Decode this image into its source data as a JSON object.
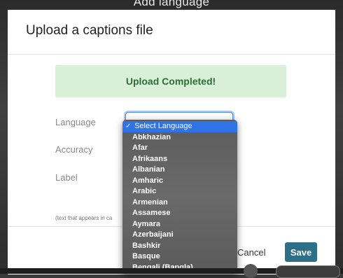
{
  "page_top": {
    "partial_title": "Add language"
  },
  "modal": {
    "title": "Upload a captions file",
    "alert": "Upload Completed!",
    "fields": {
      "language_label": "Language",
      "accuracy_label": "Accuracy",
      "label_label": "Label"
    },
    "helper_text": "(text that appears in ca",
    "footer": {
      "cancel_label": "Cancel",
      "save_label": "Save"
    }
  },
  "language_dropdown": {
    "selected": "Select Language",
    "check_glyph": "✓",
    "options": [
      "Abkhazian",
      "Afar",
      "Afrikaans",
      "Albanian",
      "Amharic",
      "Arabic",
      "Armenian",
      "Assamese",
      "Aymara",
      "Azerbaijani",
      "Bashkir",
      "Basque",
      "Bengali (Bangla)"
    ]
  },
  "colors": {
    "alert_bg": "#d9efd8",
    "alert_text": "#2e6e39",
    "save_bg": "#2d6f88",
    "dropdown_selected": "#2f73e6"
  }
}
